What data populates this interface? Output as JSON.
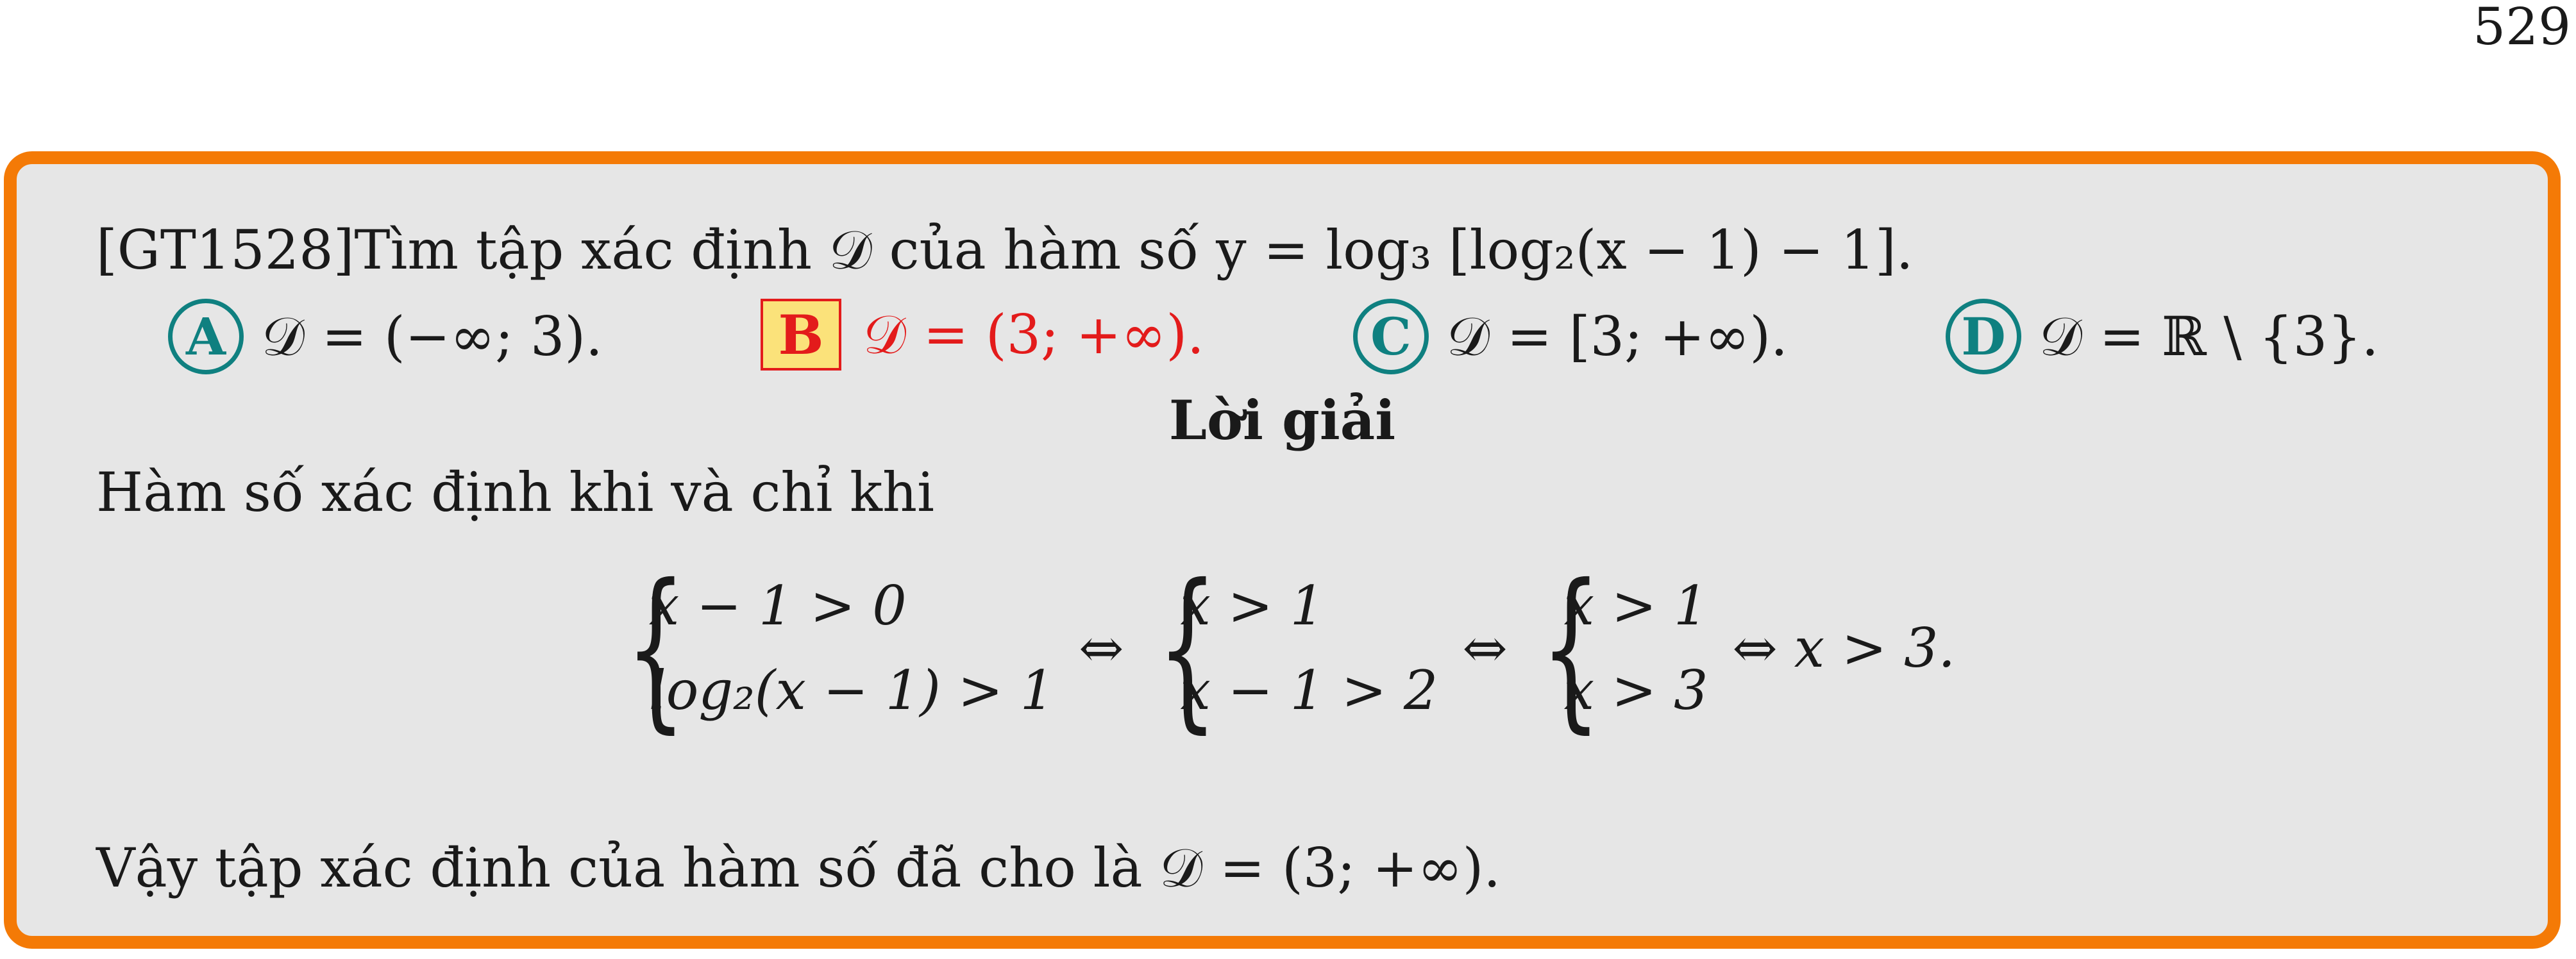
{
  "page_number": "529",
  "question": {
    "code": "[GT1528]",
    "text": "Tìm tập xác định 𝒟 của hàm số y = log₃ [log₂(x − 1) − 1]."
  },
  "choices": [
    {
      "letter": "A",
      "text": "𝒟 = (−∞; 3)."
    },
    {
      "letter": "B",
      "text": "𝒟 = (3; +∞)."
    },
    {
      "letter": "C",
      "text": "𝒟 = [3; +∞)."
    },
    {
      "letter": "D",
      "text": "𝒟 = ℝ \\ {3}."
    }
  ],
  "correct_color": "#e31b1b",
  "accent_color": "#f47a06",
  "solution": {
    "heading": "Lời giải",
    "intro": "Hàm số xác định khi và chỉ khi",
    "system": {
      "s1": [
        "x − 1 > 0",
        "log₂(x − 1) > 1"
      ],
      "s2": [
        "x > 1",
        "x − 1 > 2"
      ],
      "s3": [
        "x > 1",
        "x > 3"
      ],
      "iff": "⇔",
      "result": "x > 3."
    },
    "conclusion": "Vậy tập xác định của hàm số đã cho là 𝒟 = (3; +∞)."
  }
}
